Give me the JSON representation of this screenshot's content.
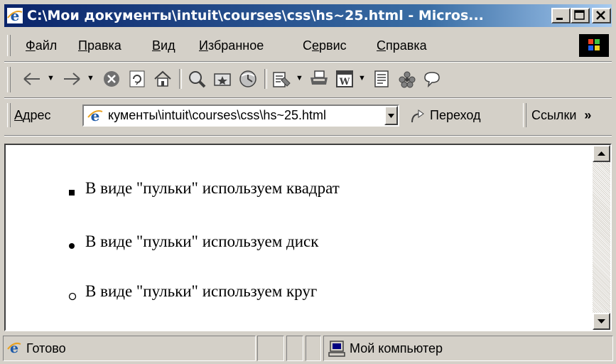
{
  "window": {
    "title": "C:\\Мои документы\\intuit\\courses\\css\\hs~25.html - Micros..."
  },
  "menu": {
    "items": [
      {
        "key": "Ф",
        "rest": "айл"
      },
      {
        "key": "П",
        "rest": "равка"
      },
      {
        "key": "В",
        "rest": "ид"
      },
      {
        "key": "И",
        "rest": "збранное"
      },
      {
        "pre": "С",
        "key": "е",
        "rest": "рвис"
      },
      {
        "key": "С",
        "rest": "правка"
      }
    ]
  },
  "address": {
    "label_key": "А",
    "label_rest": "дрес",
    "url": "кументы\\intuit\\courses\\css\\hs~25.html",
    "go_label": "Переход",
    "links_label": "Ссылки",
    "more_label": "»"
  },
  "content": {
    "items": [
      {
        "text": "В виде \"пульки\" используем квадрат",
        "bullet": "square"
      },
      {
        "text": "В виде \"пульки\" используем диск",
        "bullet": "disc"
      },
      {
        "text": "В виде \"пульки\" используем круг",
        "bullet": "circle"
      }
    ]
  },
  "status": {
    "text": "Готово",
    "zone": "Мой компьютер"
  },
  "colors": {
    "titlebar_start": "#0a246a",
    "titlebar_end": "#a6caf0",
    "face": "#d4d0c8"
  }
}
